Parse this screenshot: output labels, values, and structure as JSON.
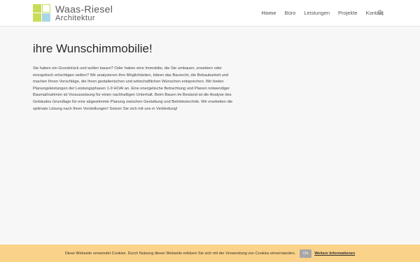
{
  "header": {
    "logo": {
      "name": "Waas-Riesel",
      "subtitle": "Architektur",
      "colors": [
        "#c9dc5a",
        "#ffffff",
        "#ffffff",
        "#a8d6e6"
      ]
    },
    "nav": [
      {
        "label": "Home",
        "active": true
      },
      {
        "label": "Büro",
        "active": false
      },
      {
        "label": "Leistungen",
        "active": false
      },
      {
        "label": "Projekte",
        "active": false
      },
      {
        "label": "Kontakt",
        "active": false
      }
    ],
    "search_icon": "search-icon"
  },
  "main": {
    "title": "ihre Wunschimmobilie!",
    "body": "Sie haben ein Grundstück und wollen bauen? Oder haben eine Immobilie, die Sie umbauen, erweitern oder energetisch ertüchtigen wollen? Wir analysieren Ihre Möglichkeiten, klären das Baurecht, die Bebaubarkeit und machen Ihnen Vorschläge, die Ihren gestalterischen und wirtschaftlichen Wünschen entsprechen. Wir bieten Planungsleistungen der Leistungsphasen 1-9 HOAI an. Eine energetische Betrachtung und Planen notwendiger Baumaßnahmen ist Voraussetzung für einen nachhaltigen Unterhalt. Beim Bauen im Bestand ist die Analyse des Gebäudes Grundlage für eine abgestimmte Planung zwischen Gestaltung und Betriebstechnik. Wir erarbeiten die optimale Lösung nach Ihren Vorstellungen! Setzen Sie sich mit uns in Verbindung!"
  },
  "cookie": {
    "text": "Diese Webseite verwendet Cookies. Durch Nutzung dieser Webseite erklären Sie sich mit der Verwendung von Cookies einverstanden.",
    "ok_label": "Ok",
    "more_label": "Weitere Informationen",
    "background": "#fbd28a"
  }
}
